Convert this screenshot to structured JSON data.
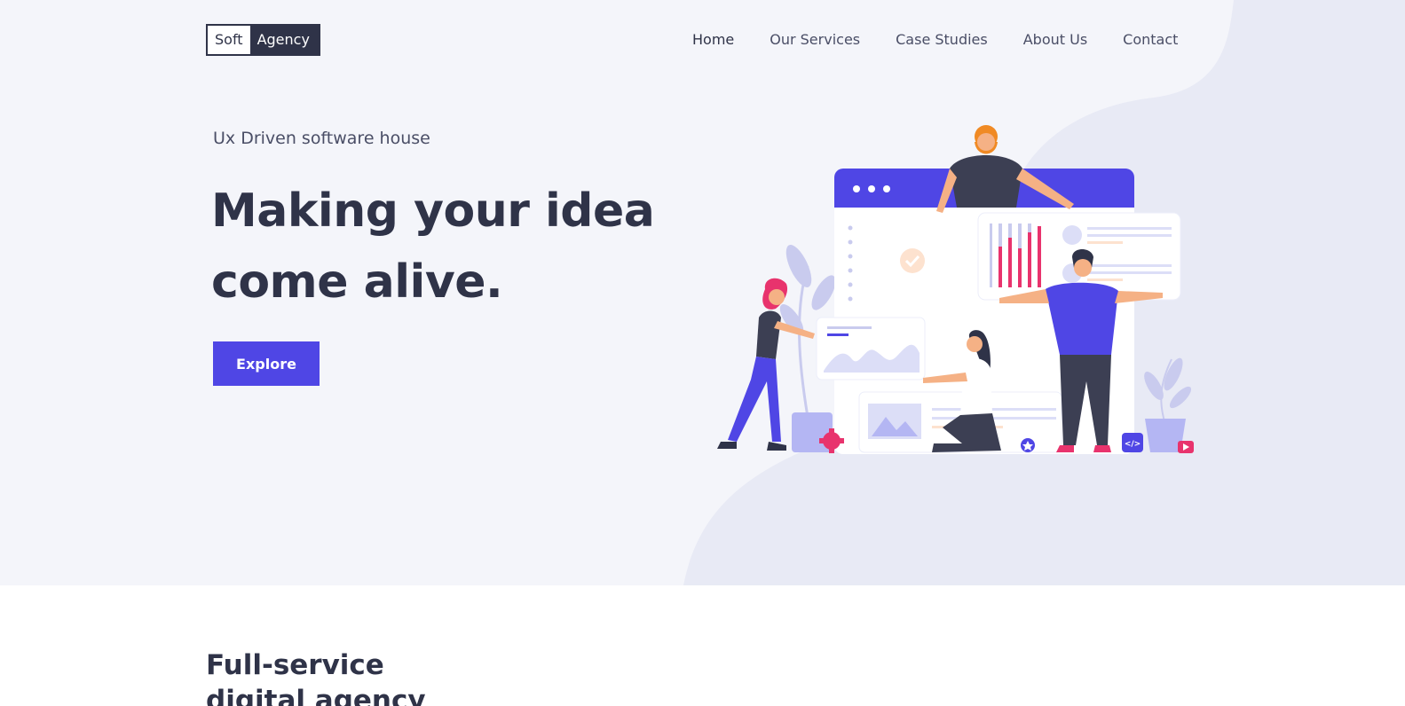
{
  "logo": {
    "part1": "Soft",
    "part2": "Agency"
  },
  "nav": {
    "items": [
      {
        "label": "Home"
      },
      {
        "label": "Our Services"
      },
      {
        "label": "Case Studies"
      },
      {
        "label": "About Us"
      },
      {
        "label": "Contact"
      }
    ],
    "active": "Home"
  },
  "hero": {
    "tagline": "Ux Driven software house",
    "headline_line1": "Making your idea",
    "headline_line2": "come alive.",
    "cta_label": "Explore",
    "illustration_code_label": "</>"
  },
  "services": {
    "title_line1": "Full-service",
    "title_line2": "digital agency"
  },
  "colors": {
    "primary": "#4f46e5",
    "dark": "#2f3348",
    "hero_bg": "#f4f5fa",
    "blob": "#e8eaf5",
    "accent_pink": "#e8336d",
    "accent_orange": "#f0a04b"
  }
}
